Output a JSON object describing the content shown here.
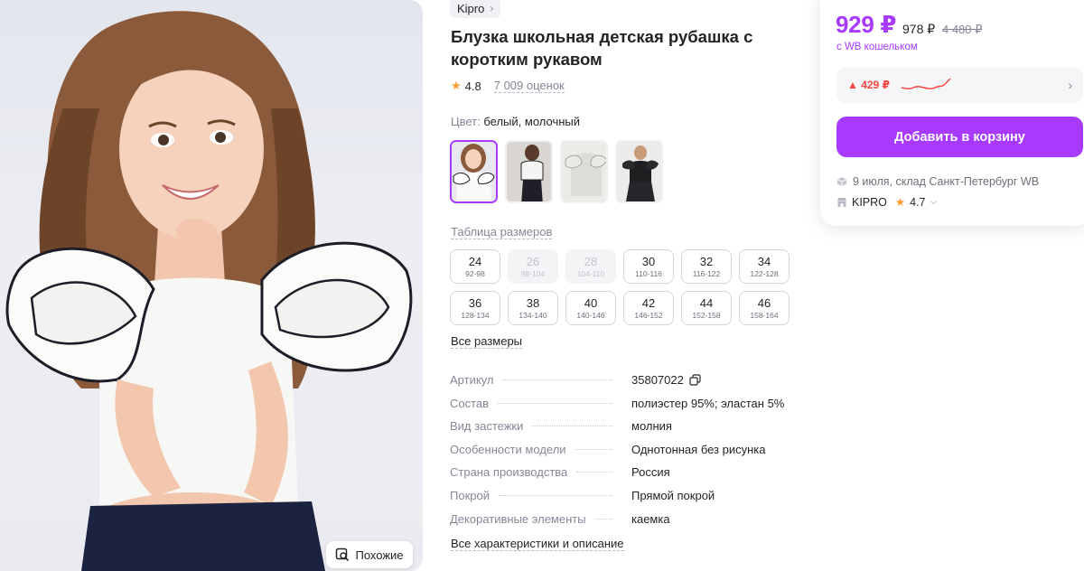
{
  "product": {
    "brand": "Kipro",
    "title": "Блузка школьная детская рубашка с коротким рукавом",
    "rating": "4.8",
    "reviews": "7 009 оценок",
    "color_label": "Цвет:",
    "color_value": "белый, молочный",
    "size_table_link": "Таблица размеров",
    "all_sizes_link": "Все размеры",
    "all_chars_link": "Все характеристики и описание",
    "similar_button": "Похожие"
  },
  "sizes": [
    {
      "num": "24",
      "range": "92-98",
      "available": true
    },
    {
      "num": "26",
      "range": "98-104",
      "available": false
    },
    {
      "num": "28",
      "range": "104-110",
      "available": false
    },
    {
      "num": "30",
      "range": "110-116",
      "available": true
    },
    {
      "num": "32",
      "range": "116-122",
      "available": true
    },
    {
      "num": "34",
      "range": "122-128",
      "available": true
    },
    {
      "num": "36",
      "range": "128-134",
      "available": true
    },
    {
      "num": "38",
      "range": "134-140",
      "available": true
    },
    {
      "num": "40",
      "range": "140-146",
      "available": true
    },
    {
      "num": "42",
      "range": "146-152",
      "available": true
    },
    {
      "num": "44",
      "range": "152-158",
      "available": true
    },
    {
      "num": "46",
      "range": "158-164",
      "available": true
    }
  ],
  "specs": [
    {
      "key": "Артикул",
      "value": "35807022"
    },
    {
      "key": "Состав",
      "value": "полиэстер 95%; эластан 5%"
    },
    {
      "key": "Вид застежки",
      "value": "молния"
    },
    {
      "key": "Особенности модели",
      "value": "Однотонная без рисунка"
    },
    {
      "key": "Страна производства",
      "value": "Россия"
    },
    {
      "key": "Покрой",
      "value": "Прямой покрой"
    },
    {
      "key": "Декоративные элементы",
      "value": "каемка"
    }
  ],
  "price": {
    "main": "929 ₽",
    "old": "978 ₽",
    "strike": "4 480 ₽",
    "wallet_note": "с WB кошельком",
    "history_change": "▲ 429 ₽",
    "cart_button": "Добавить в корзину",
    "delivery": "9 июля, склад Санкт-Петербург WB",
    "seller": "KIPRO",
    "seller_rating": "4.7"
  },
  "colors": {
    "accent": "#a73afd",
    "price_up": "#f5453d",
    "star": "#ff9d2e"
  }
}
